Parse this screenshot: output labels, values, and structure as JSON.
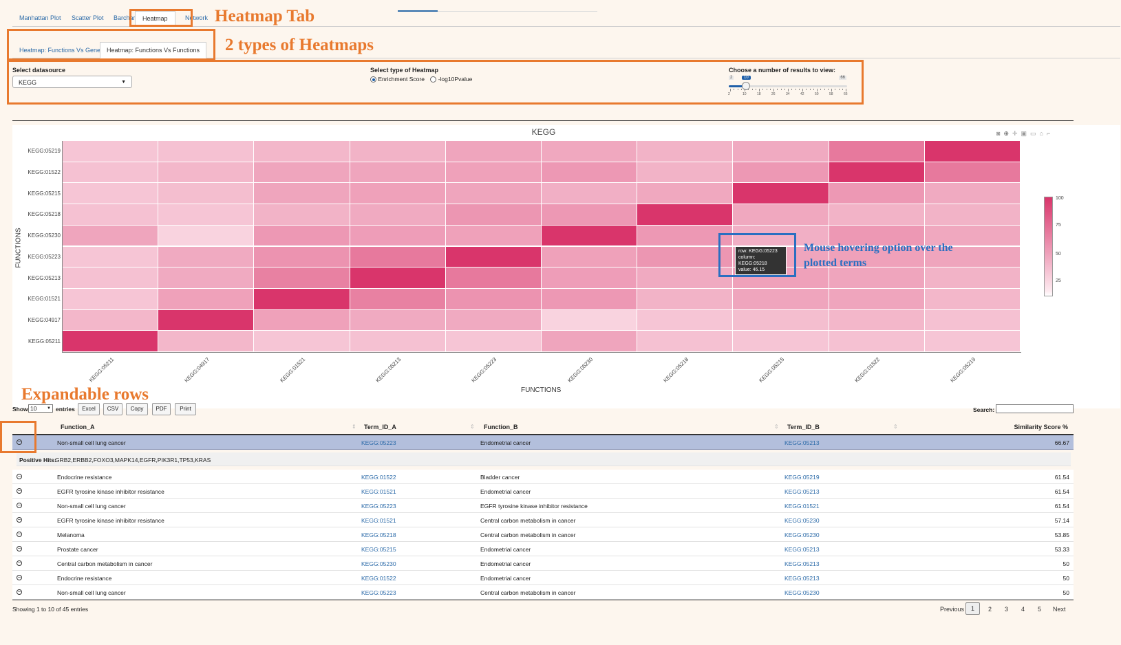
{
  "top_tabs": [
    "Manhattan Plot",
    "Scatter Plot",
    "Barchart",
    "Heatmap",
    "Network"
  ],
  "annotations": {
    "heatmap_tab": "Heatmap Tab",
    "heatmap_types": "2 types of Heatmaps",
    "hover": "Mouse hovering option over the plotted terms",
    "expandable": "Expandable rows"
  },
  "sub_tabs": [
    "Heatmap: Functions Vs Genes",
    "Heatmap: Functions Vs Functions"
  ],
  "controls": {
    "datasource_label": "Select datasource",
    "datasource_value": "KEGG",
    "type_label": "Select type of Heatmap",
    "type_options": [
      "Enrichment Score",
      "-log10Pvalue"
    ],
    "type_selected": "Enrichment Score",
    "results_label": "Choose a number of results to view:",
    "slider_min": "2",
    "slider_max": "66",
    "slider_value": "10",
    "slider_ticks": [
      "2",
      "10",
      "18",
      "26",
      "34",
      "42",
      "50",
      "58",
      "66"
    ]
  },
  "tooltip": {
    "row": "row: KEGG:05223",
    "column": "column: KEGG:05218",
    "value": "value:  46.15"
  },
  "colors": {
    "accent": "#2b6aa8",
    "annotation": "#e8792e",
    "annotation_blue": "#2a6fc1",
    "heat_low": "#fde9ef",
    "heat_high": "#d9356b"
  },
  "toolbar_icons": [
    "camera-icon",
    "zoom-icon",
    "pan-icon",
    "box-select-icon",
    "lasso-icon",
    "home-icon",
    "plotly-icon"
  ],
  "chart_data": {
    "type": "heatmap",
    "title": "KEGG",
    "xlabel": "FUNCTIONS",
    "ylabel": "FUNCTIONS",
    "x": [
      "KEGG:05211",
      "KEGG:04917",
      "KEGG:01521",
      "KEGG:05213",
      "KEGG:05223",
      "KEGG:05230",
      "KEGG:05218",
      "KEGG:05215",
      "KEGG:01522",
      "KEGG:05219"
    ],
    "y": [
      "KEGG:05211",
      "KEGG:04917",
      "KEGG:01521",
      "KEGG:05213",
      "KEGG:05223",
      "KEGG:05230",
      "KEGG:05218",
      "KEGG:05215",
      "KEGG:01522",
      "KEGG:05219"
    ],
    "z": [
      [
        100,
        28,
        20,
        22,
        20,
        38,
        22,
        20,
        22,
        20
      ],
      [
        28,
        100,
        40,
        35,
        35,
        12,
        20,
        24,
        28,
        22
      ],
      [
        20,
        40,
        100,
        58,
        48,
        45,
        30,
        38,
        38,
        28
      ],
      [
        22,
        35,
        58,
        100,
        62,
        42,
        35,
        40,
        38,
        30
      ],
      [
        20,
        35,
        48,
        62,
        100,
        40,
        46,
        38,
        40,
        38
      ],
      [
        38,
        12,
        45,
        42,
        40,
        100,
        45,
        32,
        45,
        36
      ],
      [
        22,
        20,
        30,
        35,
        46,
        45,
        100,
        36,
        30,
        30
      ],
      [
        20,
        24,
        38,
        40,
        38,
        32,
        36,
        100,
        45,
        35
      ],
      [
        22,
        28,
        38,
        38,
        40,
        45,
        30,
        45,
        100,
        62
      ],
      [
        20,
        22,
        28,
        30,
        38,
        36,
        30,
        35,
        62,
        100
      ]
    ],
    "colorbar_ticks": [
      "100",
      "75",
      "50",
      "25"
    ],
    "zlim": [
      0,
      100
    ]
  },
  "table": {
    "show_label": "Show",
    "entries_value": "10",
    "entries_label": "entries",
    "buttons": [
      "Excel",
      "CSV",
      "Copy",
      "PDF",
      "Print"
    ],
    "search_label": "Search:",
    "columns": [
      "Function_A",
      "Term_ID_A",
      "Function_B",
      "Term_ID_B",
      "Similarity Score %"
    ],
    "expanded_row": 0,
    "expanded_label": "Positive Hits:",
    "expanded_text": "GRB2,ERBB2,FOXO3,MAPK14,EGFR,PIK3R1,TP53,KRAS",
    "rows": [
      [
        "Non-small cell lung cancer",
        "KEGG:05223",
        "Endometrial cancer",
        "KEGG:05213",
        "66.67"
      ],
      [
        "Endocrine resistance",
        "KEGG:01522",
        "Bladder cancer",
        "KEGG:05219",
        "61.54"
      ],
      [
        "EGFR tyrosine kinase inhibitor resistance",
        "KEGG:01521",
        "Endometrial cancer",
        "KEGG:05213",
        "61.54"
      ],
      [
        "Non-small cell lung cancer",
        "KEGG:05223",
        "EGFR tyrosine kinase inhibitor resistance",
        "KEGG:01521",
        "61.54"
      ],
      [
        "EGFR tyrosine kinase inhibitor resistance",
        "KEGG:01521",
        "Central carbon metabolism in cancer",
        "KEGG:05230",
        "57.14"
      ],
      [
        "Melanoma",
        "KEGG:05218",
        "Central carbon metabolism in cancer",
        "KEGG:05230",
        "53.85"
      ],
      [
        "Prostate cancer",
        "KEGG:05215",
        "Endometrial cancer",
        "KEGG:05213",
        "53.33"
      ],
      [
        "Central carbon metabolism in cancer",
        "KEGG:05230",
        "Endometrial cancer",
        "KEGG:05213",
        "50"
      ],
      [
        "Endocrine resistance",
        "KEGG:01522",
        "Endometrial cancer",
        "KEGG:05213",
        "50"
      ],
      [
        "Non-small cell lung cancer",
        "KEGG:05223",
        "Central carbon metabolism in cancer",
        "KEGG:05230",
        "50"
      ]
    ],
    "info": "Showing 1 to 10 of 45 entries",
    "pagination": [
      "Previous",
      "1",
      "2",
      "3",
      "4",
      "5",
      "Next"
    ],
    "current_page": "1"
  }
}
